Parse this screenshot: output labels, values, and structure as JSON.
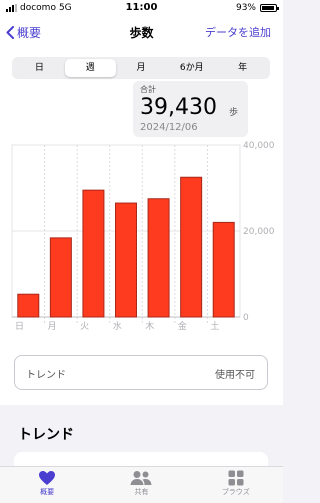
{
  "status_bar": {
    "carrier": "docomo",
    "network": "5G",
    "time": "11:00",
    "battery": "93%",
    "battery_level": 0.93
  },
  "nav": {
    "back_label": "概要",
    "title": "歩数",
    "action_label": "データを追加"
  },
  "segments": {
    "options": [
      "日",
      "週",
      "月",
      "6か月",
      "年"
    ],
    "selected": "週"
  },
  "summary": {
    "label": "合計",
    "value": "39,430",
    "unit": "歩",
    "date": "2024/12/06"
  },
  "chart_data": {
    "type": "bar",
    "categories": [
      "日",
      "月",
      "火",
      "水",
      "木",
      "金",
      "土"
    ],
    "values": [
      5300,
      18400,
      29500,
      26500,
      27500,
      32500,
      22000
    ],
    "y_ticks": [
      0,
      20000,
      40000
    ],
    "y_tick_labels": [
      "0",
      "20,000",
      "40,000"
    ],
    "ylim": [
      0,
      40000
    ],
    "grid": true,
    "bar_color": "#ff3b1f",
    "bar_edge_color": "#a8281a"
  },
  "trend_row": {
    "label": "トレンド",
    "value": "使用不可"
  },
  "section": {
    "title": "トレンド"
  },
  "tabs": [
    {
      "label": "概要",
      "icon": "heart-icon",
      "active": true
    },
    {
      "label": "共有",
      "icon": "people-icon",
      "active": false
    },
    {
      "label": "ブラウズ",
      "icon": "grid-icon",
      "active": false
    }
  ],
  "colors": {
    "accent": "#4a3ed0"
  }
}
